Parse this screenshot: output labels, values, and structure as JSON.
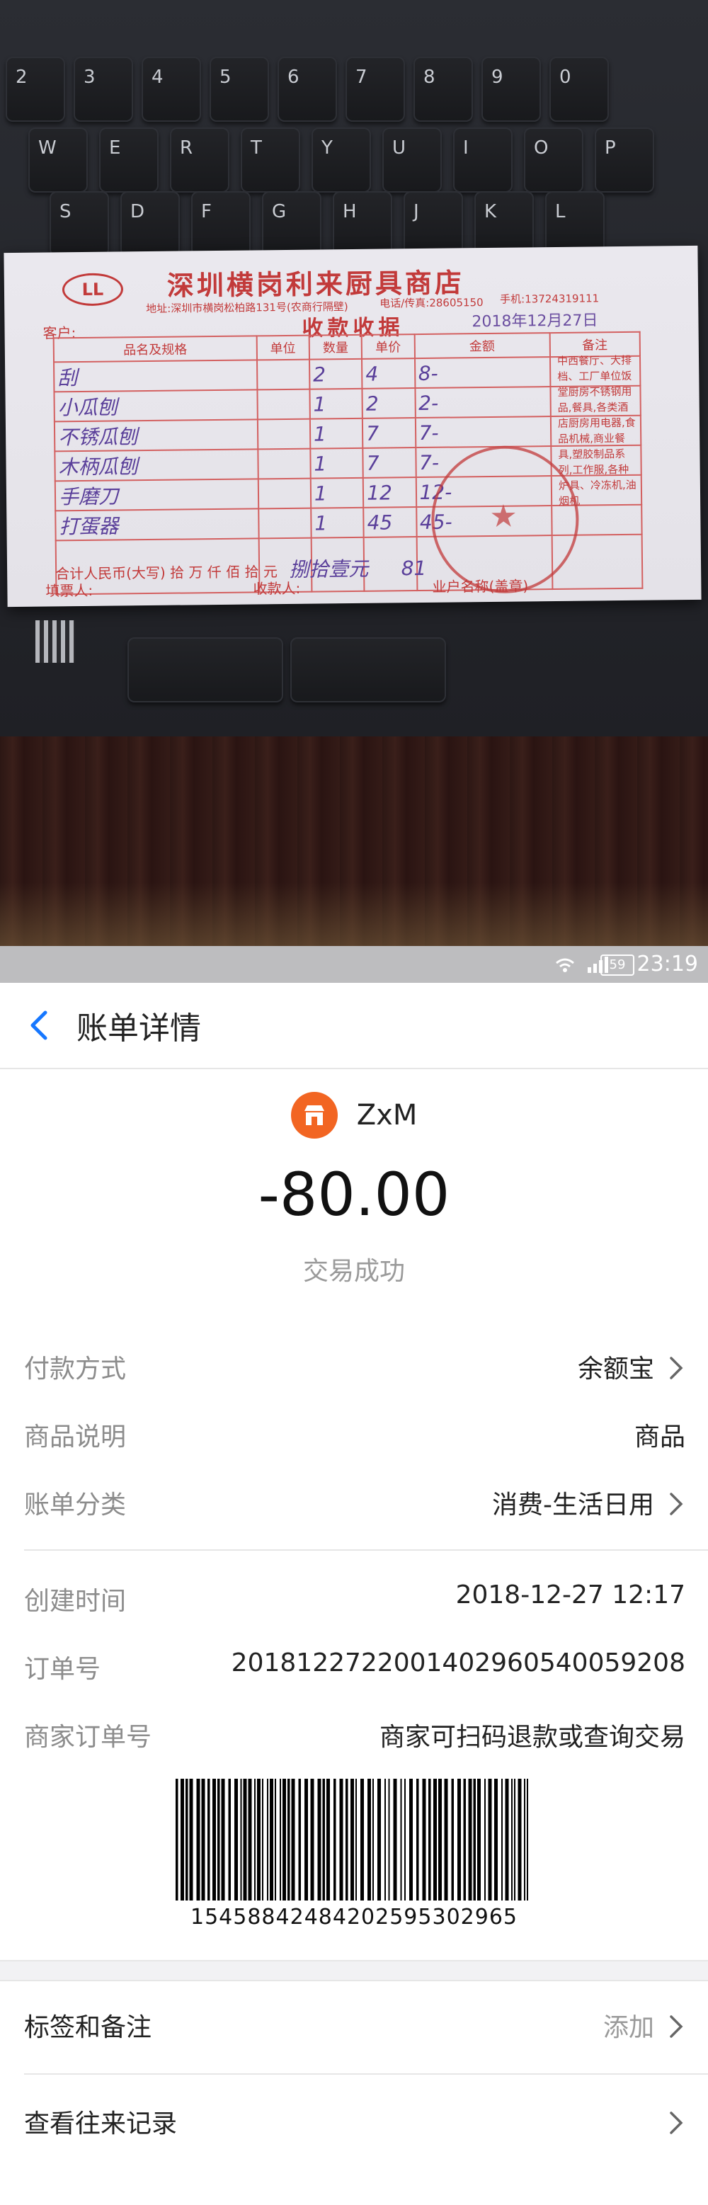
{
  "photo": {
    "keyboard_rows": [
      [
        "2",
        "3",
        "4",
        "5",
        "6",
        "7",
        "8",
        "9",
        "0"
      ],
      [
        "W",
        "E",
        "R",
        "T",
        "Y",
        "U",
        "I",
        "O",
        "P"
      ],
      [
        "S",
        "D",
        "F",
        "G",
        "H",
        "J",
        "K",
        "L"
      ]
    ],
    "receipt": {
      "logo_text": "LL",
      "shop_name": "深圳横岗利来厨具商店",
      "address": "地址:深圳市横岗松柏路131号(农商行隔壁)",
      "phone": "电话/传真:28605150",
      "mobile": "手机:13724319111",
      "customer_label": "客户:",
      "title": "收款收据",
      "date": "2018年12月27日",
      "headers": [
        "品名及规格",
        "单位",
        "数量",
        "单价",
        "金额",
        "备注"
      ],
      "items": [
        {
          "name": "刮",
          "qty": "2",
          "price": "4",
          "amount": "8-"
        },
        {
          "name": "小瓜刨",
          "qty": "1",
          "price": "2",
          "amount": "2-"
        },
        {
          "name": "不锈瓜刨",
          "qty": "1",
          "price": "7",
          "amount": "7-"
        },
        {
          "name": "木柄瓜刨",
          "qty": "1",
          "price": "7",
          "amount": "7-"
        },
        {
          "name": "手磨刀",
          "qty": "1",
          "price": "12",
          "amount": "12-"
        },
        {
          "name": "打蛋器",
          "qty": "1",
          "price": "45",
          "amount": "45-"
        }
      ],
      "note": "中西餐厅、大排档、工厂单位饭堂厨房不锈钢用品,餐具,各类酒店厨房用电器,食品机械,商业餐具,塑胶制品系列,工作服,各种炉具、冷冻机,油烟机",
      "total_label": "合计人民币(大写)   拾   万   仟   佰   拾   元",
      "total_hw": "捌拾壹元",
      "total_amount": "81",
      "filler_label": "填票人:",
      "payee_label": "收款人:",
      "business_label": "业户名称(盖章)"
    }
  },
  "statusbar": {
    "icons": "WiFi 4G",
    "battery": "59",
    "time": "23:19"
  },
  "header": {
    "title": "账单详情"
  },
  "summary": {
    "merchant": "ZxM",
    "amount": "-80.00",
    "status": "交易成功"
  },
  "details": {
    "payment_label": "付款方式",
    "payment_value": "余额宝",
    "goods_label": "商品说明",
    "goods_value": "商品",
    "category_label": "账单分类",
    "category_value": "消费-生活日用",
    "created_label": "创建时间",
    "created_value": "2018-12-27 12:17",
    "order_label": "订单号",
    "order_value": "20181227220014029605400592​08",
    "merchant_order_label": "商家订单号",
    "merchant_order_value": "商家可扫码退款或查询交易"
  },
  "barcode": {
    "number": "1545884248420259530296​5"
  },
  "links": {
    "tags_label": "标签和备注",
    "tags_action": "添加",
    "history_label": "查看往来记录"
  },
  "colors": {
    "accent_blue": "#1677ff",
    "merchant_orange": "#f26522",
    "receipt_red": "#c23a3a"
  }
}
